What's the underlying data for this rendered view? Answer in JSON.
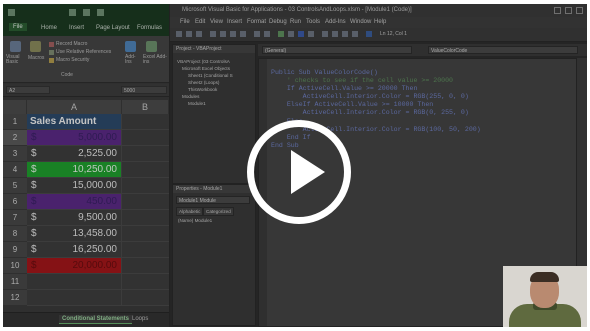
{
  "excel": {
    "tabs": [
      "File",
      "Home",
      "Insert",
      "Page Layout",
      "Formulas"
    ],
    "ribbon": {
      "visual_basic": "Visual Basic",
      "macros": "Macros",
      "record_macro": "Record Macro",
      "relative_refs": "Use Relative References",
      "macro_security": "Macro Security",
      "group_code": "Code",
      "addins": "Add-Ins",
      "excel_addins": "Excel Add-ins"
    },
    "name_box": "A2",
    "formula_value": "5000",
    "columns": [
      "A",
      "B"
    ],
    "rows": [
      {
        "num": "1",
        "header": "Sales Amount"
      },
      {
        "num": "2",
        "cur": "$",
        "amt": "5,000.00",
        "fill": "#5b2a86",
        "text": "#3a2266"
      },
      {
        "num": "3",
        "cur": "$",
        "amt": "2,525.00",
        "fill": "",
        "text": ""
      },
      {
        "num": "4",
        "cur": "$",
        "amt": "10,250.00",
        "fill": "#1f9e2e",
        "text": "#e8f5e8"
      },
      {
        "num": "5",
        "cur": "$",
        "amt": "15,000.00",
        "fill": "",
        "text": ""
      },
      {
        "num": "6",
        "cur": "$",
        "amt": "450.00",
        "fill": "#5b2a86",
        "text": "#3a2266"
      },
      {
        "num": "7",
        "cur": "$",
        "amt": "9,500.00",
        "fill": "",
        "text": ""
      },
      {
        "num": "8",
        "cur": "$",
        "amt": "13,458.00",
        "fill": "",
        "text": ""
      },
      {
        "num": "9",
        "cur": "$",
        "amt": "16,250.00",
        "fill": "",
        "text": ""
      },
      {
        "num": "10",
        "cur": "$",
        "amt": "20,000.00",
        "fill": "#a3161a",
        "text": "#6a0e10"
      },
      {
        "num": "11"
      },
      {
        "num": "12"
      }
    ],
    "sheet_tabs": [
      "Conditional Statements",
      "Loops"
    ]
  },
  "vba": {
    "title": "Microsoft Visual Basic for Applications - 03 ControlsAndLoops.xlsm - [Module1 (Code)]",
    "menu": [
      "File",
      "Edit",
      "View",
      "Insert",
      "Format",
      "Debug",
      "Run",
      "Tools",
      "Add-Ins",
      "Window",
      "Help"
    ],
    "position": "Ln 12, Col 1",
    "project_title": "Project - VBAProject",
    "tree": [
      "VBAProject (03 ControlsA",
      "Microsoft Excel Objects",
      "Sheet1 (Conditional S",
      "Sheet2 (Loops)",
      "ThisWorkbook",
      "Modules",
      "Module1"
    ],
    "properties_title": "Properties - Module1",
    "prop_object": "Module1 Module",
    "prop_tabs": [
      "Alphabetic",
      "Categorized"
    ],
    "prop_name": "(Name)   Module1",
    "combo_left": "(General)",
    "combo_right": "ValueColorCode",
    "code": [
      {
        "t": "Public Sub ValueColorCode()",
        "c": false
      },
      {
        "t": "    ' checks to see if the cell value >= 20000",
        "c": true
      },
      {
        "t": "    If ActiveCell.Value >= 20000 Then",
        "c": false
      },
      {
        "t": "        ActiveCell.Interior.Color = RGB(255, 0, 0)",
        "c": false
      },
      {
        "t": "    ElseIf ActiveCell.Value >= 10000 Then",
        "c": false
      },
      {
        "t": "        ActiveCell.Interior.Color = RGB(0, 255, 0)",
        "c": false
      },
      {
        "t": "    Else",
        "c": false
      },
      {
        "t": "        ActiveCell.Interior.Color = RGB(100, 50, 200)",
        "c": false
      },
      {
        "t": "    End If",
        "c": false
      },
      {
        "t": "End Sub",
        "c": false
      }
    ]
  },
  "overlay": {
    "play_icon": "play-icon"
  }
}
